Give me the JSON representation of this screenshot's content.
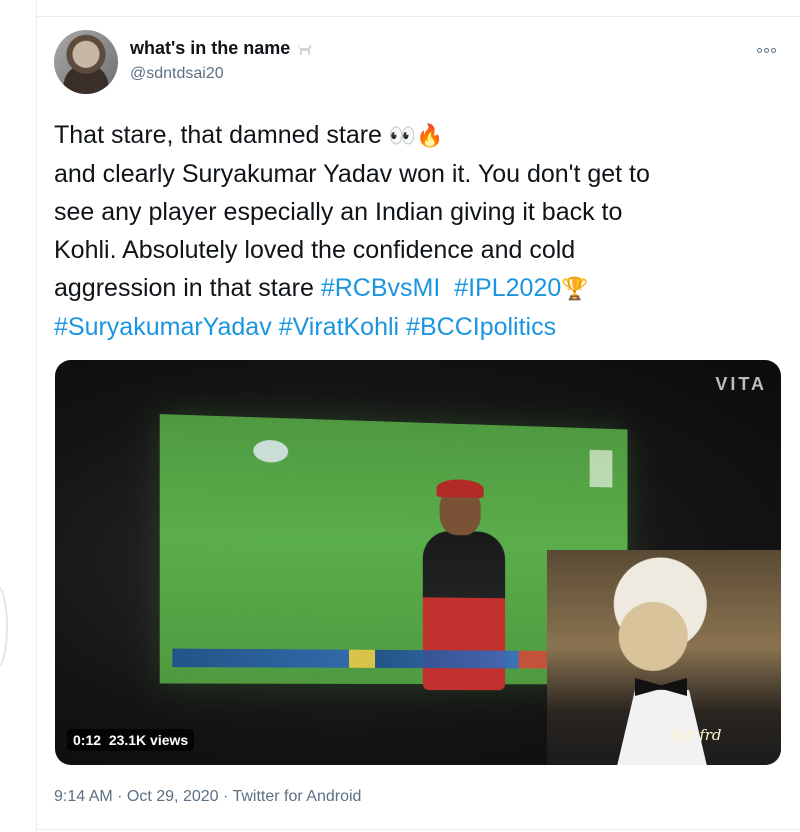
{
  "tweet": {
    "display_name": "what's in the name",
    "handle": "@sdntdsai20",
    "lines": [
      "That stare, that damned stare",
      "and clearly Suryakumar Yadav won it. You don't get to",
      "see any player especially an Indian giving it back to",
      "Kohli. Absolutely loved the confidence and cold",
      "aggression in that stare "
    ],
    "emoji_line1": "👀🔥",
    "hashtags_line5": [
      "#RCBvsMI",
      "#IPL2020"
    ],
    "trophy_emoji": "🏆",
    "hashtags_line6": [
      "#SuryakumarYadav",
      "#ViratKohli",
      "#BCCIpolitics"
    ],
    "timestamp": "9:14 AM · Oct 29, 2020",
    "separator": " · ",
    "source": "Twitter for Android"
  },
  "media": {
    "watermark": "VITA",
    "duration": "0:12",
    "views": "23.1K views",
    "overlay_caption": "Yur frd"
  },
  "icons": {
    "more": "more-options-icon",
    "goat": "goat-emoji-icon"
  },
  "colors": {
    "link": "#1b95e0",
    "secondary_text": "#5b7083",
    "primary_text": "#0f1419"
  }
}
